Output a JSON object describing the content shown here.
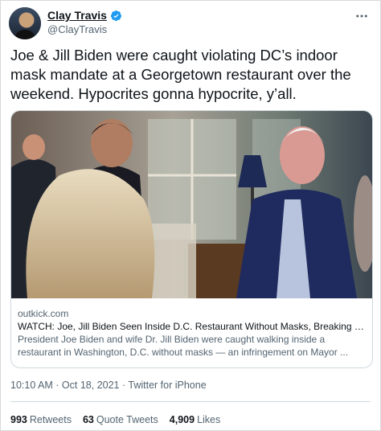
{
  "author": {
    "display_name": "Clay Travis",
    "handle": "@ClayTravis"
  },
  "colors": {
    "verified_blue": "#1d9bf0",
    "secondary_text": "#536471",
    "border": "#cfd9de"
  },
  "icons": {
    "verified": "verified-badge-icon",
    "more": "more-icon"
  },
  "tweet": {
    "text": "Joe & Jill Biden were caught violating DC’s indoor mask mandate at a Georgetown restaurant over the weekend. Hypocrites gonna hypocrite, y’all."
  },
  "card": {
    "domain": "outkick.com",
    "title": "WATCH: Joe, Jill Biden Seen Inside D.C. Restaurant Without Masks, Breaking C...",
    "description": "President Joe Biden and wife Dr. Jill Biden were caught walking inside a restaurant in Washington, D.C. without masks — an infringement on Mayor ..."
  },
  "meta": {
    "timestamp": "10:10 AM · Oct 18, 2021 · Twitter for iPhone"
  },
  "stats": {
    "retweets_count": "993",
    "retweets_label": "Retweets",
    "quotes_count": "63",
    "quotes_label": "Quote Tweets",
    "likes_count": "4,909",
    "likes_label": "Likes"
  }
}
